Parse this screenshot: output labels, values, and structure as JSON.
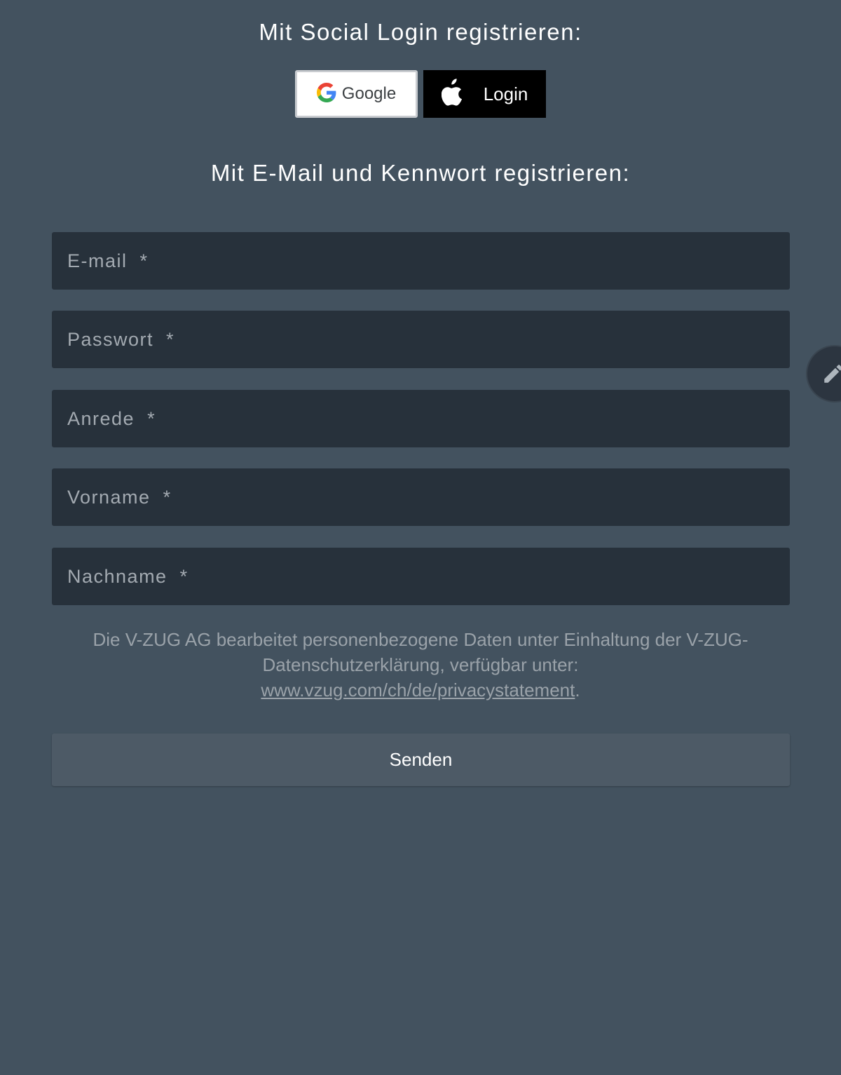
{
  "social": {
    "heading": "Mit Social Login registrieren:",
    "google_label": "Google",
    "apple_label": "Login"
  },
  "email_section": {
    "heading": "Mit E-Mail und Kennwort registrieren:"
  },
  "fields": {
    "email_placeholder": "E-mail  *",
    "password_placeholder": "Passwort  *",
    "salutation_placeholder": "Anrede  *",
    "firstname_placeholder": "Vorname  *",
    "lastname_placeholder": "Nachname  *"
  },
  "privacy": {
    "text": "Die V-ZUG AG bearbeitet personenbezogene Daten unter Einhaltung der V-ZUG-Datenschutzerklärung, verfügbar unter:",
    "link_text": "www.vzug.com/ch/de/privacystatement",
    "trailing": "."
  },
  "submit_label": "Senden",
  "icons": {
    "google": "google-g-logo",
    "apple": "apple-logo",
    "edit": "pencil-icon"
  },
  "colors": {
    "background": "#43525f",
    "field_background": "#27313b",
    "submit_background": "#4d5a66"
  }
}
